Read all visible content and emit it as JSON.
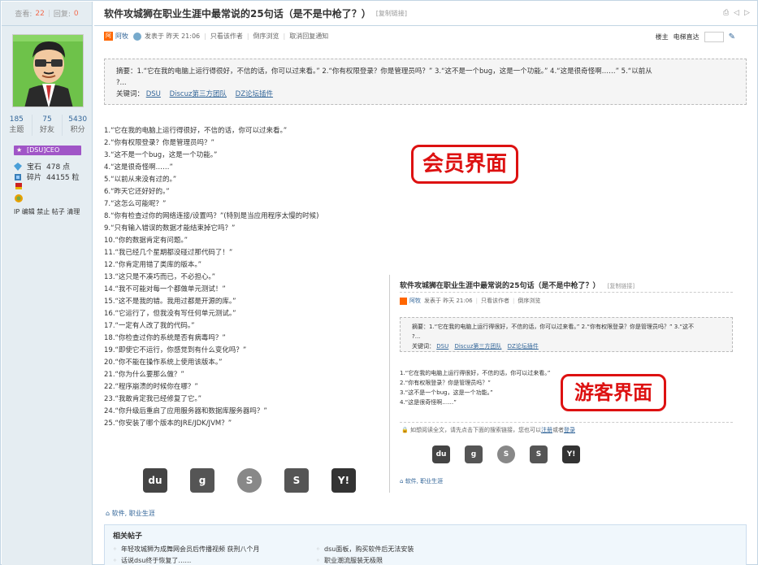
{
  "sidebar": {
    "views_label": "查看:",
    "views": "22",
    "replies_label": "回复:",
    "replies": "0",
    "stats": [
      {
        "value": "185",
        "label": "主题"
      },
      {
        "value": "75",
        "label": "好友"
      },
      {
        "value": "5430",
        "label": "积分"
      }
    ],
    "rank": "[DSU]CEO",
    "credits": [
      {
        "name": "宝石",
        "value": "478 点"
      },
      {
        "name": "碎片",
        "value": "44155 粒"
      }
    ],
    "admin_links": "IP 编辑 禁止 帖子 清理"
  },
  "thread": {
    "title": "软件攻城狮在职业生涯中最常说的25句话（是不是中枪了？）",
    "copy_link": "[复制链接]",
    "author": "阿牧",
    "posted": "发表于 昨天 21:06",
    "only_author": "只看该作者",
    "reverse": "倒序浏览",
    "cancel_reply_notify": "取消回复通知",
    "floor_label": "楼主",
    "floor_jump": "电梯直达"
  },
  "summary": {
    "label": "摘要：",
    "text": "1.“它在我的电脑上运行得很好，不信的话，你可以过来看。” 2.“你有权限登录？你是管理员吗？” 3.“这不是一个bug，这是一个功能。” 4.“这是很奇怪啊……” 5.“以前从",
    "text2": "?...",
    "keywords_label": "关键词：",
    "keywords": [
      "DSU",
      "Discuz第三方团队",
      "DZ论坛插件"
    ]
  },
  "content_lines": [
    "1.“它在我的电脑上运行得很好，不信的话，你可以过来看。”",
    "2.“你有权限登录？你是管理员吗？”",
    "3.“这不是一个bug，这是一个功能。”",
    "4.“这是很奇怪啊……”",
    "5.“以前从来没有过的。”",
    "6.“昨天它还好好的。”",
    "7.“这怎么可能呢？”",
    "8.“你有检查过你的网络连接/设置吗？”(特别是当应用程序太慢的时候)",
    "9.“只有输入错误的数据才能结束掉它吗？”",
    "10.“你的数据肯定有问题。”",
    "11.“我已经几个星期都没碰过那代码了！”",
    "12.“你肯定用错了类库的版本。”",
    "13.“这只是不凑巧而已，不必担心。”",
    "14.“我不可能对每一个都做单元测试！”",
    "15.“这不是我的错。我用过都是开源的库。”",
    "16.“它运行了，但我没有写任何单元测试。”",
    "17.“一定有人改了我的代码。”",
    "18.“你检查过你的系统是否有病毒吗？”",
    "19.“即使它不运行，你感觉到有什么变化吗？”",
    "20.“你不能在操作系统上使用该版本。”",
    "21.“你为什么要那么做？”",
    "22.“程序崩溃的时候你在哪？”",
    "23.“我敢肯定我已经修复了它。”",
    "24.“你升级后重启了应用服务器和数据库服务器吗？”",
    "25.“你安装了哪个版本的JRE/JDK/JVM？”"
  ],
  "stamps": {
    "member": "会员界面",
    "guest": "游客界面"
  },
  "share_icons": [
    "du",
    "g",
    "S",
    "S",
    "Y!"
  ],
  "tags": "软件, 职业生涯",
  "related": {
    "title": "相关帖子",
    "items": [
      "年轻攻城狮为成舞网会员后传播视频 获刑八个月",
      "dsu面板，购买软件后无法安装",
      "话说dsu终于恢复了……",
      "职业潮流服装无极限"
    ]
  },
  "inset": {
    "title": "软件攻城狮在职业生涯中最常说的25句话（是不是中枪了？）",
    "copy_link": "[复制链接]",
    "author": "阿牧",
    "posted": "发表于 昨天 21:06",
    "only_author": "只看该作者",
    "reverse": "倒序浏览",
    "summary_label": "摘要：",
    "summary_text": "1.“它在我的电脑上运行得很好，不信的话，你可以过来看。” 2.“你有权限登录？你是管理员吗？” 3.“这不",
    "summary_text2": "?...",
    "keywords_label": "关键词：",
    "keywords": [
      "DSU",
      "Discuz第三方团队",
      "DZ论坛插件"
    ],
    "lines": [
      "1.“它在我的电脑上运行得很好，不信的话，你可以过来看。”",
      "2.“你有权限登录？你是管理员吗？”",
      "3.“这不是一个bug，这是一个功能。”",
      "4.“这是很奇怪啊……”"
    ],
    "notice_prefix": "如想阅读全文，请先点击下面的搜索链接，您也可以",
    "notice_register": "注册",
    "notice_or": "或者",
    "notice_login": "登录",
    "tags": "软件, 职业生涯"
  }
}
